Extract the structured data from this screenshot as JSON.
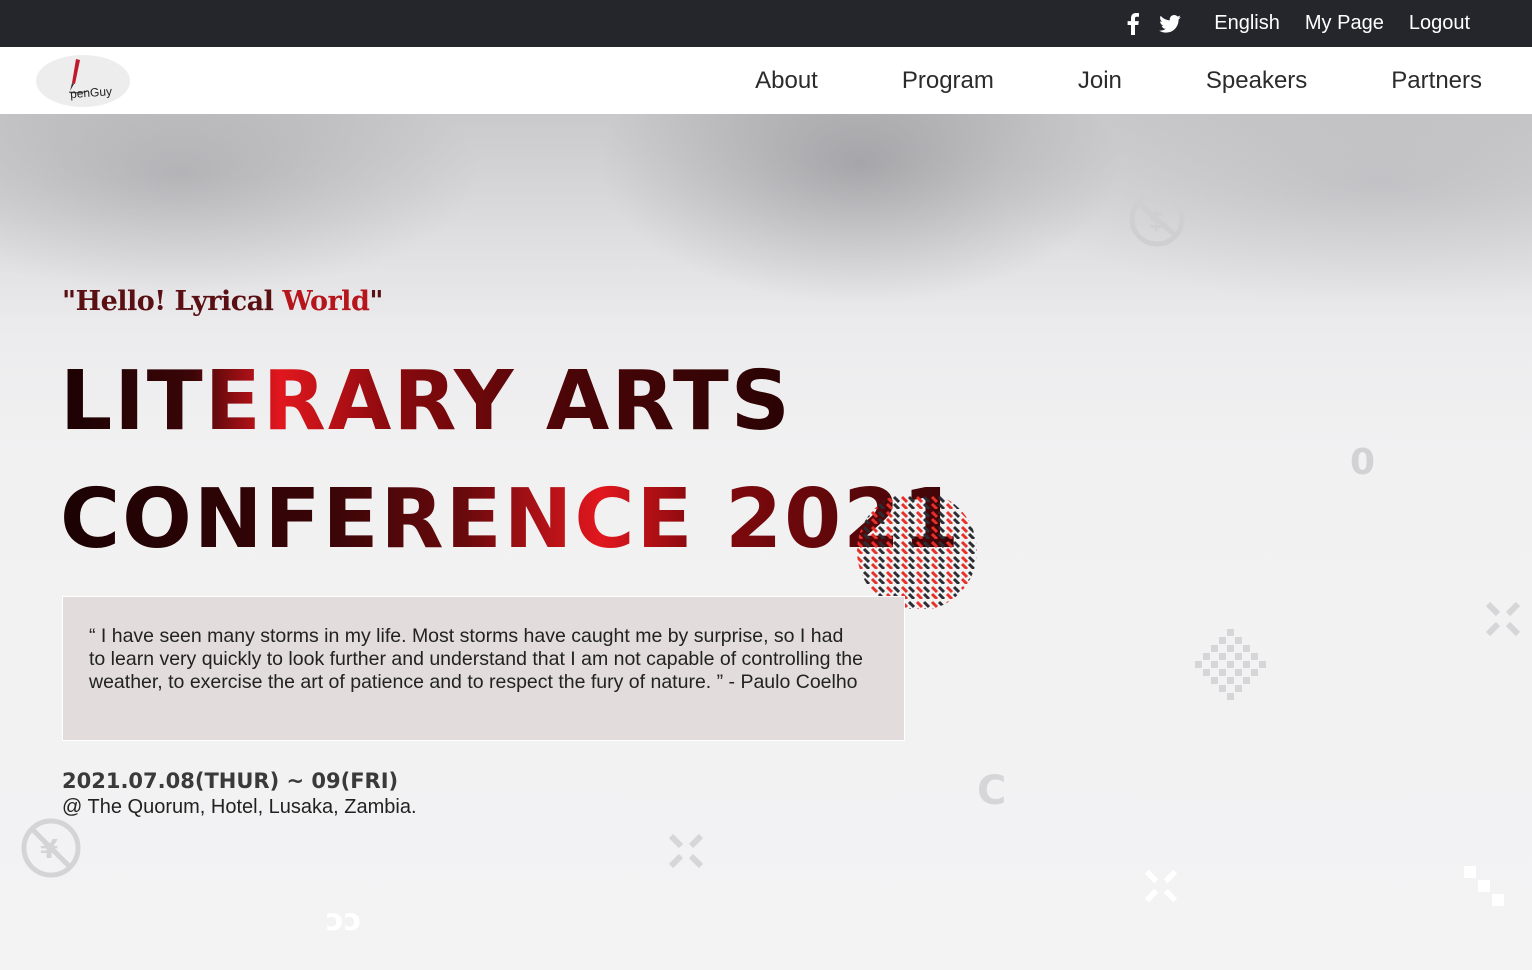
{
  "topbar": {
    "social": [
      {
        "icon": "facebook-icon"
      },
      {
        "icon": "twitter-icon"
      }
    ],
    "language_label": "English",
    "mypage_label": "My Page",
    "logout_label": "Logout"
  },
  "logo": {
    "text": "penGuy"
  },
  "nav": {
    "items": [
      "About",
      "Program",
      "Join",
      "Speakers",
      "Partners"
    ]
  },
  "hero": {
    "tagline_part1": "\"Hello! Lyrical ",
    "tagline_part2": "World",
    "tagline_part3": "\"",
    "title_line1": "LITERARY ARTS",
    "title_line2": "CONFERENCE 2021",
    "quote": "“ I have seen many storms in my life. Most storms have caught me by surprise, so I had to learn very quickly to look further and understand that I am not capable of controlling the weather, to exercise the art of patience and to respect the fury of nature. ” - Paulo Coelho",
    "date": "2021.07.08(THUR) ~ 09(FRI)",
    "venue": "@ The Quorum, Hotel, Lusaka, Zambia."
  },
  "colors": {
    "topbar_bg": "#24262b",
    "accent_red": "#e2171e",
    "dark_red": "#5a0f12",
    "quote_bg": "#e2dcdc"
  }
}
